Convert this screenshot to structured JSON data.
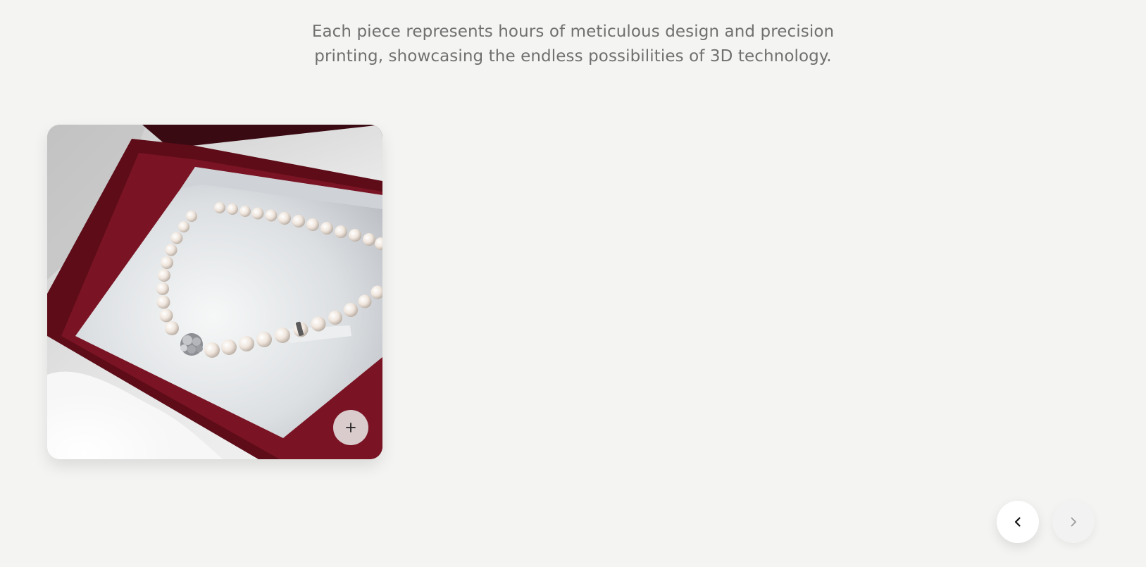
{
  "intro": {
    "line1": "Each piece represents hours of meticulous design and precision",
    "line2": "printing, showcasing the endless possibilities of 3D technology."
  },
  "gallery": {
    "items": [
      {
        "image": "pearl-necklace-in-red-jewelry-box",
        "expand_icon": "plus-icon"
      }
    ],
    "prev_icon": "chevron-left-icon",
    "next_icon": "chevron-right-icon"
  },
  "colors": {
    "background": "#f4f4f2",
    "text": "#707070",
    "box_red": "#6e1020"
  }
}
